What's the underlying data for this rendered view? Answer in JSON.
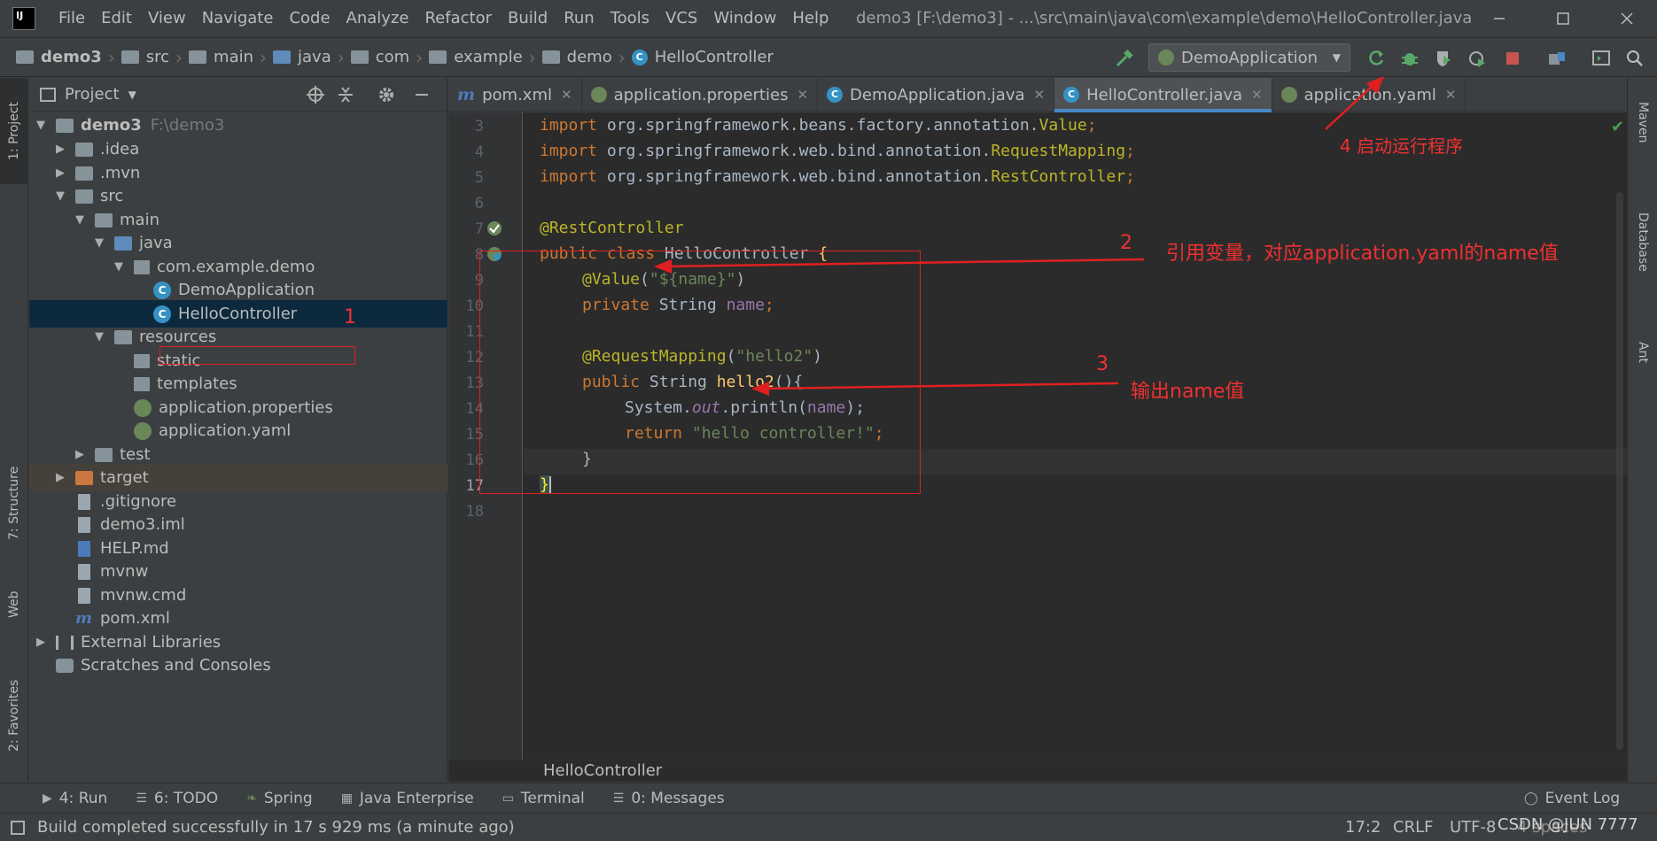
{
  "menu": {
    "items": [
      "File",
      "Edit",
      "View",
      "Navigate",
      "Code",
      "Analyze",
      "Refactor",
      "Build",
      "Run",
      "Tools",
      "VCS",
      "Window",
      "Help"
    ],
    "window_title": "demo3 [F:\\demo3] - ...\\src\\main\\java\\com\\example\\demo\\HelloController.java"
  },
  "navbar": {
    "crumbs": [
      "demo3",
      "src",
      "main",
      "java",
      "com",
      "example",
      "demo",
      "HelloController"
    ],
    "run_config": "DemoApplication"
  },
  "left_strip": {
    "project": "1: Project",
    "structure": "7: Structure",
    "web": "Web",
    "favorites": "2: Favorites"
  },
  "right_strip": {
    "maven": "Maven",
    "database": "Database",
    "ant": "Ant"
  },
  "project_panel": {
    "title": "Project",
    "tree": [
      {
        "label": "demo3",
        "hint": "F:\\demo3"
      },
      {
        "label": ".idea"
      },
      {
        "label": ".mvn"
      },
      {
        "label": "src"
      },
      {
        "label": "main"
      },
      {
        "label": "java"
      },
      {
        "label": "com.example.demo"
      },
      {
        "label": "DemoApplication"
      },
      {
        "label": "HelloController"
      },
      {
        "label": "resources"
      },
      {
        "label": "static"
      },
      {
        "label": "templates"
      },
      {
        "label": "application.properties"
      },
      {
        "label": "application.yaml"
      },
      {
        "label": "test"
      },
      {
        "label": "target"
      },
      {
        "label": ".gitignore"
      },
      {
        "label": "demo3.iml"
      },
      {
        "label": "HELP.md"
      },
      {
        "label": "mvnw"
      },
      {
        "label": "mvnw.cmd"
      },
      {
        "label": "pom.xml"
      },
      {
        "label": "External Libraries"
      },
      {
        "label": "Scratches and Consoles"
      }
    ]
  },
  "tabs": [
    "pom.xml",
    "application.properties",
    "DemoApplication.java",
    "HelloController.java",
    "application.yaml"
  ],
  "editor": {
    "line_numbers": [
      "3",
      "4",
      "5",
      "6",
      "7",
      "8",
      "9",
      "10",
      "11",
      "12",
      "13",
      "14",
      "15",
      "16",
      "17",
      "18"
    ],
    "imports": [
      {
        "pkg": "org.springframework.beans.factory.annotation.",
        "cls": "Value"
      },
      {
        "pkg": "org.springframework.web.bind.annotation.",
        "cls": "RequestMapping"
      },
      {
        "pkg": "org.springframework.web.bind.annotation.",
        "cls": "RestController"
      }
    ],
    "ann_rest": "@RestController",
    "class_decl": {
      "kw": "public class ",
      "name": "HelloController ",
      "brace": "{"
    },
    "value_ann": {
      "ann": "@Value",
      "open": "(",
      "str": "\"${name}\"",
      "close": ")"
    },
    "field_decl": {
      "kw": "private ",
      "type": "String ",
      "name": "name",
      "semi": ";"
    },
    "req_ann": {
      "ann": "@RequestMapping",
      "open": "(",
      "str": "\"hello2\"",
      "close": ")"
    },
    "method_decl": {
      "kw": "public ",
      "type": "String ",
      "name": "hello2",
      "rest": "(){"
    },
    "println": {
      "a": "System.",
      "b": "out",
      "c": ".println(",
      "d": "name",
      "e": ");"
    },
    "ret": {
      "kw": "return ",
      "str": "\"hello controller!\"",
      "semi": ";"
    },
    "close_inner": "}",
    "close_outer": "}",
    "bottom_crumb": "HelloController"
  },
  "bottom_tools": [
    "4: Run",
    "6: TODO",
    "Spring",
    "Java Enterprise",
    "Terminal",
    "0: Messages",
    "Event Log"
  ],
  "status": {
    "message": "Build completed successfully in 17 s 929 ms (a minute ago)",
    "position": "17:2",
    "line_sep": "CRLF",
    "encoding": "UTF-8",
    "indent": "4 spaces",
    "watermark": "CSDN @JUN 7777"
  },
  "annotations": {
    "a1": "1",
    "a2": "2",
    "a2_text": "引用变量，对应application.yaml的name值",
    "a3": "3",
    "a3_text": "输出name值",
    "a4_text": "4 启动运行程序"
  },
  "colors": {
    "accent": "#4a88c7",
    "annotation_red": "#f03030",
    "keyword": "#cc7832",
    "annotation": "#bbb529",
    "string": "#6a8759"
  }
}
